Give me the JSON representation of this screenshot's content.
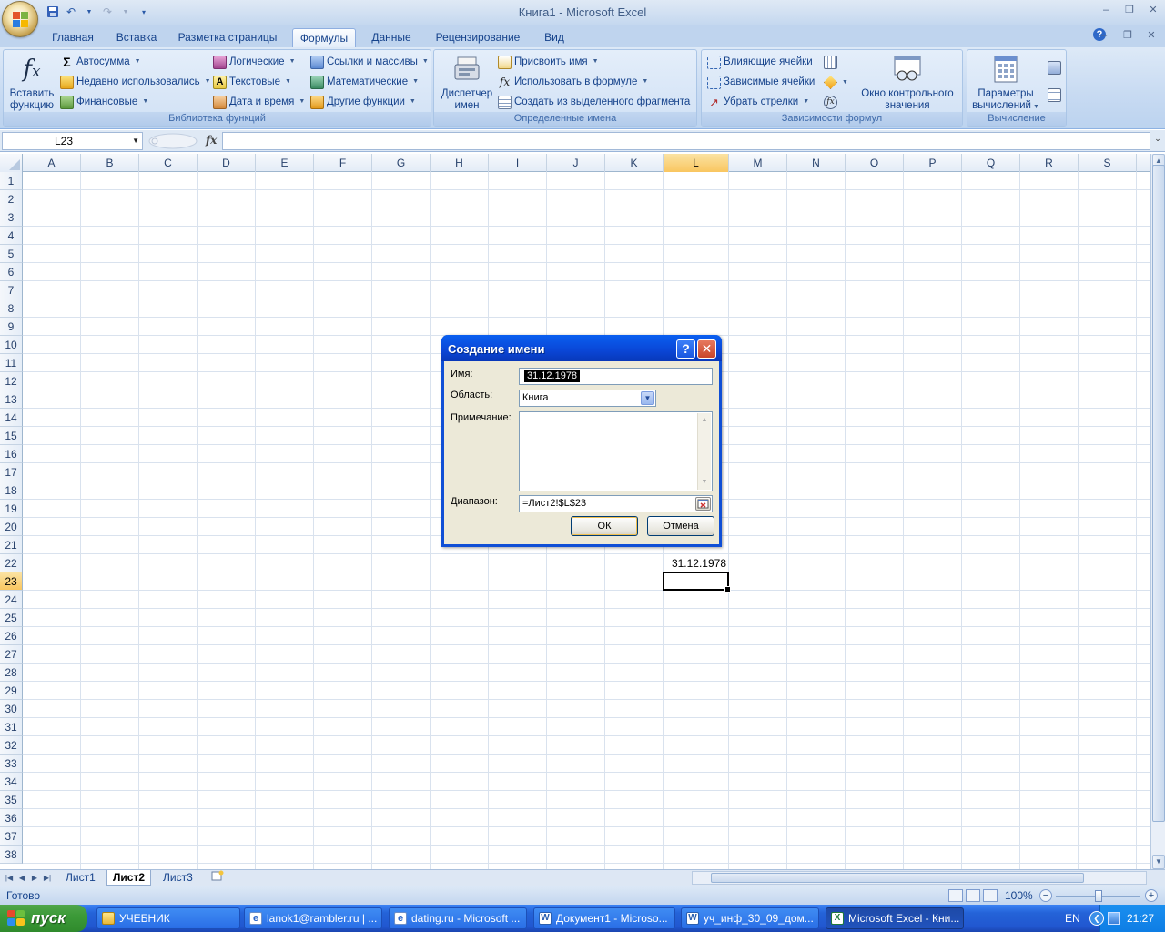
{
  "window": {
    "title": "Книга1 - Microsoft Excel"
  },
  "ribbon_tabs": [
    {
      "label": "Главная"
    },
    {
      "label": "Вставка"
    },
    {
      "label": "Разметка страницы"
    },
    {
      "label": "Формулы",
      "active": true
    },
    {
      "label": "Данные"
    },
    {
      "label": "Рецензирование"
    },
    {
      "label": "Вид"
    }
  ],
  "ribbon": {
    "function_library": {
      "label": "Библиотека функций",
      "insert_function": {
        "line1": "Вставить",
        "line2": "функцию",
        "icon": "fx-icon"
      },
      "autosum": "Автосумма",
      "recently_used": "Недавно использовались",
      "financial": "Финансовые",
      "logical": "Логические",
      "text": "Текстовые",
      "date_time": "Дата и время",
      "lookup": "Ссылки и массивы",
      "math": "Математические",
      "more": "Другие функции"
    },
    "defined_names": {
      "label": "Определенные имена",
      "manager": {
        "line1": "Диспетчер",
        "line2": "имен"
      },
      "define_name": "Присвоить имя",
      "use_in_formula": "Использовать в формуле",
      "create_from_selection": "Создать из выделенного фрагмента"
    },
    "formula_auditing": {
      "label": "Зависимости формул",
      "trace_precedents": "Влияющие ячейки",
      "trace_dependents": "Зависимые ячейки",
      "remove_arrows": "Убрать стрелки",
      "watch_window": {
        "line1": "Окно контрольного",
        "line2": "значения"
      }
    },
    "calculation": {
      "label": "Вычисление",
      "options": {
        "line1": "Параметры",
        "line2": "вычислений"
      }
    }
  },
  "formula_bar": {
    "name_box": "L23",
    "fx": "fx",
    "value": ""
  },
  "grid": {
    "columns": [
      "A",
      "B",
      "C",
      "D",
      "E",
      "F",
      "G",
      "H",
      "I",
      "J",
      "K",
      "L",
      "M",
      "N",
      "O",
      "P",
      "Q",
      "R",
      "S"
    ],
    "rows": [
      "1",
      "2",
      "3",
      "4",
      "5",
      "6",
      "7",
      "8",
      "9",
      "10",
      "11",
      "12",
      "13",
      "14",
      "15",
      "16",
      "17",
      "18",
      "19",
      "20",
      "21",
      "22",
      "23",
      "24",
      "25",
      "26",
      "27",
      "28",
      "29",
      "30",
      "31",
      "32",
      "33",
      "34",
      "35",
      "36",
      "37",
      "38"
    ],
    "selected_column": "L",
    "selected_row": "23",
    "cells": {
      "L22": "31.12.1978"
    }
  },
  "sheets": [
    {
      "label": "Лист1"
    },
    {
      "label": "Лист2",
      "active": true
    },
    {
      "label": "Лист3"
    }
  ],
  "status": {
    "text": "Готово",
    "zoom": "100%"
  },
  "dialog": {
    "title": "Создание имени",
    "name_label": "Имя:",
    "name_value": "31.12.1978",
    "scope_label": "Область:",
    "scope_value": "Книга",
    "comment_label": "Примечание:",
    "comment_value": "",
    "range_label": "Диапазон:",
    "range_value": "=Лист2!$L$23",
    "ok": "ОК",
    "cancel": "Отмена"
  },
  "taskbar": {
    "start": "пуск",
    "items": [
      {
        "label": "УЧЕБНИК",
        "icon": "folder-icon"
      },
      {
        "label": "lanok1@rambler.ru | ...",
        "icon": "ie-icon"
      },
      {
        "label": "dating.ru - Microsoft ...",
        "icon": "ie-icon"
      },
      {
        "label": "Документ1 - Microso...",
        "icon": "word-icon"
      },
      {
        "label": "уч_инф_30_09_дом...",
        "icon": "word-icon"
      },
      {
        "label": "Microsoft Excel - Кни...",
        "icon": "excel-icon",
        "active": true
      }
    ],
    "lang": "EN",
    "clock": "21:27"
  },
  "colors": {
    "ribbon_accent": "#15428b",
    "selection_header": "#f9c660",
    "xp_title_blue": "#0a46d6",
    "taskbar_blue": "#2463d8",
    "start_green": "#3c9a38"
  }
}
